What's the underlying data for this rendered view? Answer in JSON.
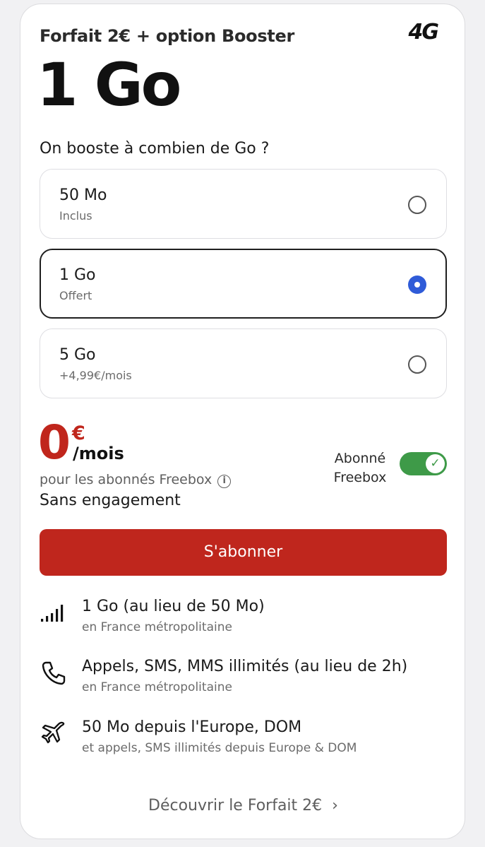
{
  "header": {
    "subtitle": "Forfait 2€ + option Booster",
    "network_badge": "4G",
    "hero": "1 Go"
  },
  "booster": {
    "question": "On booste à combien de Go ?",
    "options": [
      {
        "label": "50 Mo",
        "sub": "Inclus",
        "selected": false
      },
      {
        "label": "1 Go",
        "sub": "Offert",
        "selected": true
      },
      {
        "label": "5 Go",
        "sub": "+4,99€/mois",
        "selected": false
      }
    ]
  },
  "price": {
    "amount": "0",
    "currency": "€",
    "period": "/mois",
    "note": "pour les abonnés Freebox",
    "commitment": "Sans engagement"
  },
  "toggle": {
    "label": "Abonné Freebox",
    "on": true
  },
  "cta": {
    "label": "S'abonner"
  },
  "features": [
    {
      "icon": "signal-bars-icon",
      "title": "1 Go (au lieu de 50 Mo)",
      "sub": "en France métropolitaine"
    },
    {
      "icon": "phone-icon",
      "title": "Appels, SMS, MMS illimités (au lieu de 2h)",
      "sub": "en France métropolitaine"
    },
    {
      "icon": "airplane-icon",
      "title": "50 Mo depuis l'Europe, DOM",
      "sub": "et appels, SMS illimités depuis Europe & DOM"
    }
  ],
  "footer": {
    "discover_link": "Découvrir le Forfait 2€"
  },
  "colors": {
    "accent_red": "#bf261d",
    "radio_blue": "#2f5bd8",
    "toggle_green": "#3e9a48"
  }
}
